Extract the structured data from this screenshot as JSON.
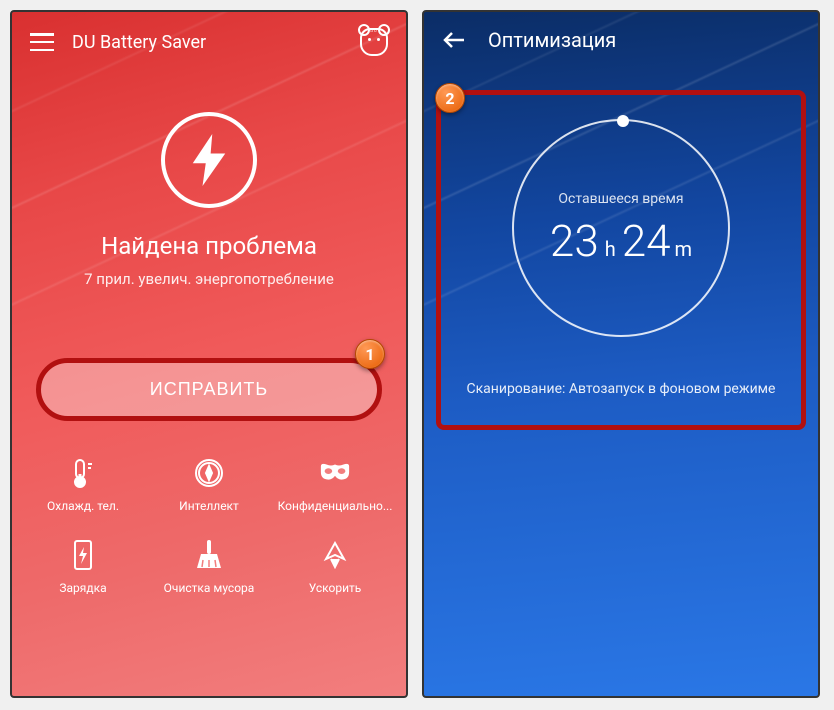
{
  "left": {
    "appTitle": "DU Battery Saver",
    "problemTitle": "Найдена проблема",
    "problemSubtitle": "7 прил. увелич. энергопотребление",
    "fixButton": "ИСПРАВИТЬ",
    "badge1": "1",
    "features": [
      {
        "label": "Охлажд. тел."
      },
      {
        "label": "Интеллект"
      },
      {
        "label": "Конфиденциально..."
      },
      {
        "label": "Зарядка"
      },
      {
        "label": "Очистка мусора"
      },
      {
        "label": "Ускорить"
      }
    ]
  },
  "right": {
    "title": "Оптимизация",
    "badge2": "2",
    "remainingLabel": "Оставшееся время",
    "hours": "23",
    "hUnit": "h",
    "minutes": "24",
    "mUnit": "m",
    "scanStatus": "Сканирование: Автозапуск в фоновом режиме"
  }
}
